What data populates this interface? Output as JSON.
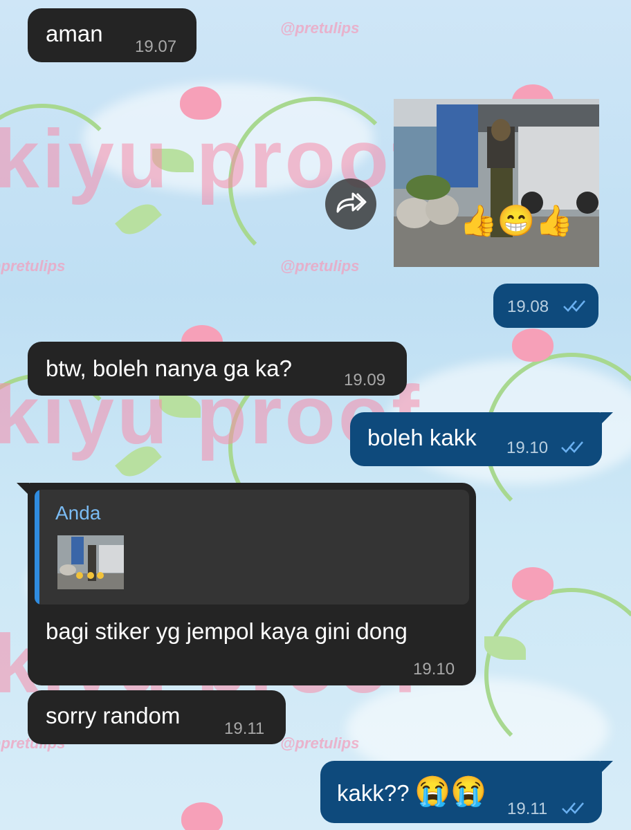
{
  "messages": [
    {
      "id": "m1",
      "direction": "incoming",
      "text": "aman",
      "time": "19.07"
    },
    {
      "id": "m2",
      "direction": "outgoing",
      "type": "forwarded-photo",
      "time": "19.08",
      "read": true
    },
    {
      "id": "m3",
      "direction": "incoming",
      "text": "btw, boleh nanya ga ka?",
      "time": "19.09"
    },
    {
      "id": "m4",
      "direction": "outgoing",
      "text": "boleh kakk",
      "time": "19.10",
      "read": true
    },
    {
      "id": "m5",
      "direction": "incoming",
      "reply_to": {
        "name": "Anda",
        "type": "photo"
      },
      "text": "bagi stiker yg jempol kaya gini dong",
      "time": "19.10"
    },
    {
      "id": "m6",
      "direction": "incoming",
      "text": "sorry random",
      "time": "19.11"
    },
    {
      "id": "m7",
      "direction": "outgoing",
      "text": "kakk??",
      "emoji": "😭😭",
      "time": "19.11",
      "read": true
    }
  ],
  "photo_emoji": "👍😁👍",
  "wallpaper": {
    "watermark_big": "kiyu proof",
    "watermark_small": "@pretulips"
  },
  "icons": {
    "forward": "forward-arrow-icon",
    "read_receipt": "double-check-icon"
  },
  "colors": {
    "incoming_bubble": "#242424",
    "outgoing_bubble": "#0e4a7c",
    "reply_accent": "#2f8ce0",
    "reply_name": "#7bbcf4",
    "tick": "#6ab0f0"
  }
}
